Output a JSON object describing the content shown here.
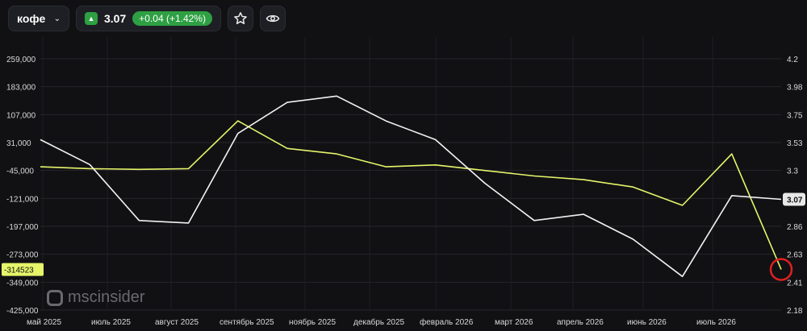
{
  "toolbar": {
    "symbol": "кофе",
    "price": "3.07",
    "change": "+0.04 (+1.42%)",
    "icons": [
      "chevron-down-icon",
      "triangle-up-icon",
      "star-icon",
      "eye-icon"
    ]
  },
  "brand": "mscinsider",
  "colors": {
    "background": "#111114",
    "price_line": "#f2f2f2",
    "positions_line": "#e6f56a",
    "change_badge": "#2ea043",
    "marker": "#e02020"
  },
  "chart_data": {
    "type": "line",
    "x_labels": [
      "май 2025",
      "июль 2025",
      "август 2025",
      "сентябрь 2025",
      "ноябрь 2025",
      "декабрь 2025",
      "февраль 2026",
      "март 2026",
      "апрель 2026",
      "июнь 2026",
      "июль 2026"
    ],
    "left_axis": {
      "ticks": [
        "259,000",
        "183,000",
        "107,000",
        "31,000",
        "-45,000",
        "-121,000",
        "-197,000",
        "-273,000",
        "-349,000",
        "-425,000"
      ],
      "range": [
        -425000,
        259000
      ]
    },
    "right_axis": {
      "ticks": [
        "4.2",
        "3.98",
        "3.75",
        "3.53",
        "3.3",
        "3.08",
        "2.86",
        "2.63",
        "2.41",
        "2.18"
      ],
      "range": [
        2.18,
        4.2
      ]
    },
    "last_price_label": "3.07",
    "last_position_label": "-314523",
    "x": [
      "2025-05",
      "2025-06",
      "2025-07",
      "2025-08",
      "2025-09",
      "2025-10",
      "2025-11",
      "2025-12",
      "2026-01",
      "2026-02",
      "2026-03",
      "2026-04",
      "2026-05",
      "2026-06",
      "2026-07",
      "2026-08"
    ],
    "series": [
      {
        "axis": "right",
        "values": [
          3.55,
          3.35,
          2.9,
          2.88,
          3.6,
          3.85,
          3.9,
          3.7,
          3.55,
          3.2,
          2.9,
          2.95,
          2.75,
          2.45,
          3.1,
          3.07
        ]
      },
      {
        "axis": "left",
        "values": [
          -35000,
          -40000,
          -42000,
          -40000,
          90000,
          15000,
          0,
          -35000,
          -30000,
          -45000,
          -60000,
          -70000,
          -90000,
          -140000,
          0,
          -314523
        ]
      }
    ],
    "grid": true,
    "marker": "circle-at-last-point"
  }
}
